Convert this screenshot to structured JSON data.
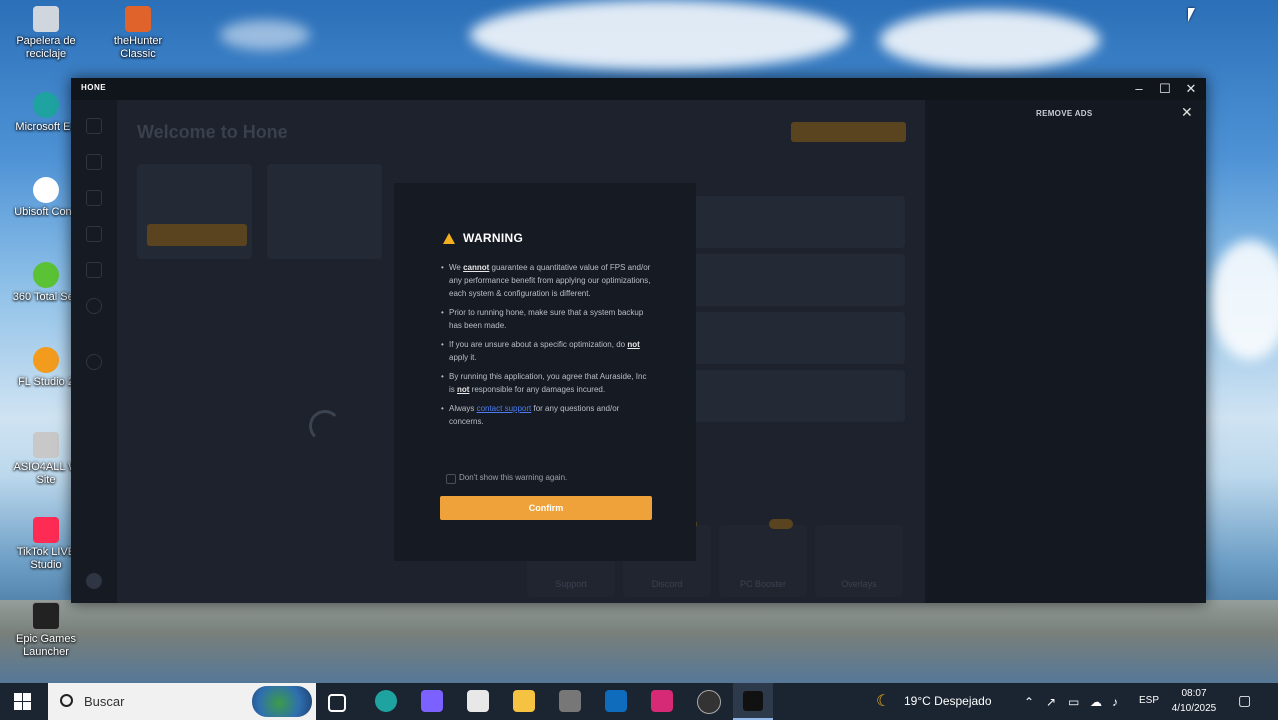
{
  "desktop": {
    "icons": [
      {
        "label": "Papelera de reciclaje"
      },
      {
        "label": "theHunter Classic"
      },
      {
        "label": "Microsoft Ed"
      },
      {
        "label": "Ubisoft Conn"
      },
      {
        "label": "360 Total Sec"
      },
      {
        "label": "FL Studio 2"
      },
      {
        "label": "ASIO4ALL W Site"
      },
      {
        "label": "TikTok LIVE Studio"
      },
      {
        "label": "Epic Games Launcher"
      }
    ]
  },
  "app": {
    "logo": "HONE",
    "welcome_title": "Welcome to Hone",
    "remove_ads": "REMOVE ADS",
    "tiles": [
      {
        "label": "Support"
      },
      {
        "label": "Discord"
      },
      {
        "label": "PC Booster"
      },
      {
        "label": "Overlays"
      }
    ]
  },
  "modal": {
    "title": "WARNING",
    "bullets": [
      {
        "pre": "We ",
        "bold": "cannot",
        "post": " guarantee a quantitative value of FPS and/or any performance benefit from applying our optimizations, each system & configuration is different."
      },
      {
        "pre": "Prior to running hone, make sure that a system backup has been made.",
        "bold": "",
        "post": ""
      },
      {
        "pre": "If you are unsure about a specific optimization, do ",
        "bold": "not",
        "post": " apply it."
      },
      {
        "pre": "By running this application, you agree that Auraside, Inc is ",
        "bold": "not",
        "post": " responsible for any damages incured."
      },
      {
        "pre": "Always ",
        "link": "contact support",
        "post": " for any questions and/or concerns."
      }
    ],
    "checkbox_label": "Don't show this warning again.",
    "confirm_label": "Confirm"
  },
  "taskbar": {
    "search_placeholder": "Buscar",
    "weather": "19°C  Despejado",
    "language": "ESP",
    "time": "08:07",
    "date": "4/10/2025"
  },
  "colors": {
    "accent": "#f0a23a",
    "warning": "#f2b01e",
    "link": "#4b7cf0"
  }
}
